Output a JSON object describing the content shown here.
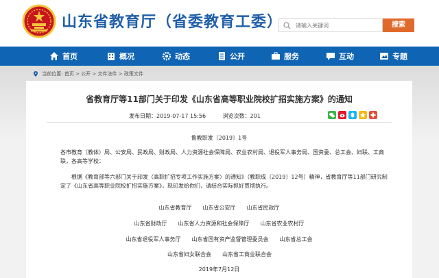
{
  "header": {
    "site_title": "山东省教育厅（省委教育工委）",
    "search_placeholder": "请输入关键词",
    "search_button": "搜索"
  },
  "nav": {
    "items": [
      {
        "label": "首页",
        "icon": "home-icon"
      },
      {
        "label": "概况",
        "icon": "building-icon"
      },
      {
        "label": "动态",
        "icon": "gear-icon"
      },
      {
        "label": "公开",
        "icon": "document-icon"
      },
      {
        "label": "服务",
        "icon": "service-icon"
      },
      {
        "label": "互动",
        "icon": "chat-icon"
      },
      {
        "label": "专题",
        "icon": "topic-icon"
      }
    ]
  },
  "breadcrumb": {
    "location_label": "当前位置:",
    "items": [
      "首页",
      "公开",
      "文件法件",
      "政策文件"
    ],
    "separator": ">"
  },
  "article": {
    "title": "省教育厅等11部门关于印发《山东省高等职业院校扩招实施方案》的通知",
    "publish_time": "发布日期：2019-07-17 15:56",
    "views": "浏览次数：201",
    "doc_number": "鲁教职发〔2019〕1号",
    "paragraph1": "各市教育（教体）局、公安局、民政局、财政局、人力资源社会保障局、农业农村局、退役军人事务局、国资委、总工会、妇联、工商联，各高等学校：",
    "paragraph2": "根据《教育部等六部门关于印发〈高职扩招专项工作实施方案〉的通知》（教职成〔2019〕12号）精神，省教育厅等11部门研究制定了《山东省高等职业院校扩招实施方案》，现印发给你们，请结合实际抓好贯彻执行。",
    "signatories": [
      [
        "山东省教育厅",
        "山东省公安厅",
        "山东省民政厅"
      ],
      [
        "山东省财政厅",
        "山东省人力资源和社会保障厅",
        "山东省农业农村厅"
      ],
      [
        "山东省退役军人事务厅",
        "山东省国有资产监督管理委员会",
        "山东省总工会"
      ],
      [
        "山东省妇女联合会",
        "山东省工商业联合会"
      ]
    ],
    "date": "2019年7月12日"
  },
  "share_icons": [
    "weixin-share-icon",
    "weibo-share-icon",
    "qq-share-icon",
    "qzone-share-icon",
    "more-share-icon"
  ],
  "colors": {
    "brand": "#1f5ea8",
    "nav_bg": "#0f64b4",
    "search_button": "#e06a2c",
    "emblem_red": "#c8161d",
    "emblem_gold": "#f2c53d"
  }
}
